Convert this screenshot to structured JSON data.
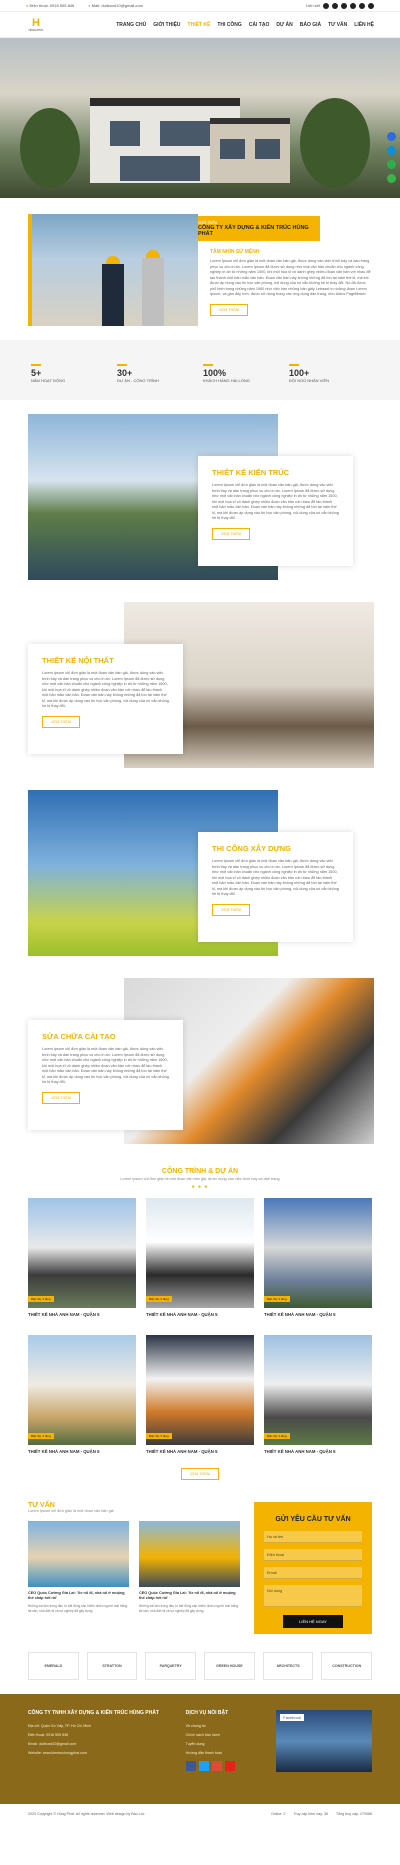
{
  "topbar": {
    "phone": "Điện thoại: 0916 505 848",
    "email": "Mail: dulieuxd10@gmail.com",
    "lang": "Liên kết"
  },
  "nav": {
    "logo_mark": "H",
    "logo_text": "HÙNG PHÁT",
    "items": [
      "TRANG CHỦ",
      "GIỚI THIỆU",
      "THIẾT KẾ",
      "THI CÔNG",
      "CẢI TẠO",
      "DỰ ÁN",
      "BÁO GIÁ",
      "TƯ VẤN",
      "LIÊN HỆ"
    ],
    "active_index": 2
  },
  "intro": {
    "ribbon_small": "Giới thiệu",
    "ribbon_title": "CÔNG TY XÂY DỰNG & KIẾN TRÚC HÙNG PHÁT",
    "subtitle": "TẦM NHÌN SỨ MỆNH",
    "text": "Lorem Ipsum chỉ đơn giản là một đoạn văn bản giả, được dùng vào việc trình bày và dàn trang phục vụ cho in ấn. Lorem Ipsum đã được sử dụng như một văn bản chuẩn cho ngành công nghiệp in ấn từ những năm 1500, khi một họa sĩ vô danh ghép nhiều đoạn văn bản với nhau để tạo thành một bản mẫu văn bản. Đoạn văn bản này không những đã tồn tại năm thế kỉ, mà khi được áp dụng vào tin học văn phòng, nội dung của nó vẫn không hề bị thay đổi. Nó đã được phổ biến trong những năm 1960 nhờ việc bán những bản giấy Letraset in những đoạn Lorem Ipsum, và gần đây hơn, được sử dụng trong các ứng dụng dàn trang, như Aldus PageMaker.",
    "button": "XEM THÊM"
  },
  "stats": [
    {
      "number": "5+",
      "label": "NĂM HOẠT ĐỘNG"
    },
    {
      "number": "30+",
      "label": "DỰ ÁN - CÔNG TRÌNH"
    },
    {
      "number": "100%",
      "label": "KHÁCH HÀNG HÀI LÒNG"
    },
    {
      "number": "100+",
      "label": "ĐỘI NGŨ NHÂN VIÊN"
    }
  ],
  "services": [
    {
      "title": "THIẾT KẾ KIẾN TRÚC",
      "text": "Lorem Ipsum chỉ đơn giản là một đoạn văn bản giả, được dùng vào việc trình bày và dàn trang phục vụ cho in ấn. Lorem Ipsum đã được sử dụng như một văn bản chuẩn cho ngành công nghiệp in ấn từ những năm 1500, khi một họa sĩ vô danh ghép nhiều đoạn văn bản với nhau để tạo thành một bản mẫu văn bản. Đoạn văn bản này không những đã tồn tại năm thế kỉ, mà khi được áp dụng vào tin học văn phòng, nội dung của nó vẫn không hề bị thay đổi.",
      "button": "XEM THÊM"
    },
    {
      "title": "THIẾT KẾ NỘI THẤT",
      "text": "Lorem Ipsum chỉ đơn giản là một đoạn văn bản giả, được dùng vào việc trình bày và dàn trang phục vụ cho in ấn. Lorem Ipsum đã được sử dụng như một văn bản chuẩn cho ngành công nghiệp in ấn từ những năm 1500, khi một họa sĩ vô danh ghép nhiều đoạn văn bản với nhau để tạo thành một bản mẫu văn bản. Đoạn văn bản này không những đã tồn tại năm thế kỉ, mà khi được áp dụng vào tin học văn phòng, nội dung của nó vẫn không hề bị thay đổi.",
      "button": "XEM THÊM"
    },
    {
      "title": "THI CÔNG XÂY DỰNG",
      "text": "Lorem Ipsum chỉ đơn giản là một đoạn văn bản giả, được dùng vào việc trình bày và dàn trang phục vụ cho in ấn. Lorem Ipsum đã được sử dụng như một văn bản chuẩn cho ngành công nghiệp in ấn từ những năm 1500, khi một họa sĩ vô danh ghép nhiều đoạn văn bản với nhau để tạo thành một bản mẫu văn bản. Đoạn văn bản này không những đã tồn tại năm thế kỉ, mà khi được áp dụng vào tin học văn phòng, nội dung của nó vẫn không hề bị thay đổi.",
      "button": "XEM THÊM"
    },
    {
      "title": "SỬA CHỮA CẢI TẠO",
      "text": "Lorem Ipsum chỉ đơn giản là một đoạn văn bản giả, được dùng vào việc trình bày và dàn trang phục vụ cho in ấn. Lorem Ipsum đã được sử dụng như một văn bản chuẩn cho ngành công nghiệp in ấn từ những năm 1500, khi một họa sĩ vô danh ghép nhiều đoạn văn bản với nhau để tạo thành một bản mẫu văn bản. Đoạn văn bản này không những đã tồn tại năm thế kỉ, mà khi được áp dụng vào tin học văn phòng, nội dung của nó vẫn không hề bị thay đổi.",
      "button": "XEM THÊM"
    }
  ],
  "projects": {
    "title": "CÔNG TRÌNH & DỰ ÁN",
    "subtitle": "Lorem Ipsum chỉ đơn giản là một đoạn văn bản giả, được dùng vào việc trình bày và dàn trang",
    "tag": "Biệt thự 3 tầng",
    "items": [
      "THIẾT KẾ NHÀ ANH NAM - QUẬN 5",
      "THIẾT KẾ NHÀ ANH NAM - QUẬN 5",
      "THIẾT KẾ NHÀ ANH NAM - QUẬN 5",
      "THIẾT KẾ NHÀ ANH NAM - QUẬN 5",
      "THIẾT KẾ NHÀ ANH NAM - QUẬN 5",
      "THIẾT KẾ NHÀ ANH NAM - QUẬN 5"
    ],
    "button": "XEM THÊM"
  },
  "news": {
    "title": "TƯ VẤN",
    "subtitle": "Lorem Ipsum chỉ đơn giản là một đoạn văn bản giả",
    "items": [
      {
        "title": "CEO Quốc Cường Gia Lai: 'Xe nổ đi, nhà nổ ở muộng thế chấp hết rồi'",
        "excerpt": "Những sai lầm trong đầu tư bất động sản khiến nhiều người mất trắng tài sản, nhà đất rồi cả sự nghiệp đã gây dựng."
      },
      {
        "title": "CEO Quốc Cường Gia Lai: 'Xe nổ đi, nhà nổ ở muộng thế chấp hết rồi'",
        "excerpt": "Những sai lầm trong đầu tư bất động sản khiến nhiều người mất trắng tài sản, nhà đất rồi cả sự nghiệp đã gây dựng."
      }
    ]
  },
  "form": {
    "title": "GỬI YÊU CẦU TƯ VẤN",
    "fields": [
      "Họ và tên",
      "Điện thoại",
      "Email",
      "Nội dung"
    ],
    "submit": "LIÊN HỆ NGAY"
  },
  "partners": [
    "EMERALD",
    "STRATTON",
    "PARQUETRY",
    "GREEN HOUSE",
    "ARCHITECTS",
    "CONSTRUCTION"
  ],
  "footer": {
    "company": "CÔNG TY TNHH XÂY DỰNG & KIẾN TRÚC HÙNG PHÁT",
    "lines": [
      "Địa chỉ: Quận Gò Vấp, TP. Hồ Chí Minh",
      "Điện thoại: 0916 505 848",
      "Email: dulieuxd10@gmail.com",
      "Website: www.kientruchungphat.com"
    ],
    "links_title": "DỊCH VỤ NỔI BẬT",
    "links": [
      "Về chúng tôi",
      "Chính sách bảo hành",
      "Tuyển dụng",
      "Hướng dẫn thanh toán"
    ],
    "facebook": "Facebook"
  },
  "bottom": {
    "copyright": "2020 Copyright © Hùng Phát. All rights reserved. Web design by Bảo Lộc",
    "stats": [
      "Online: 2",
      "Truy cập hôm nay: 36",
      "Tổng truy cập: 270086"
    ]
  },
  "colors": {
    "accent": "#f3b300",
    "footer": "#8a6a1a"
  }
}
